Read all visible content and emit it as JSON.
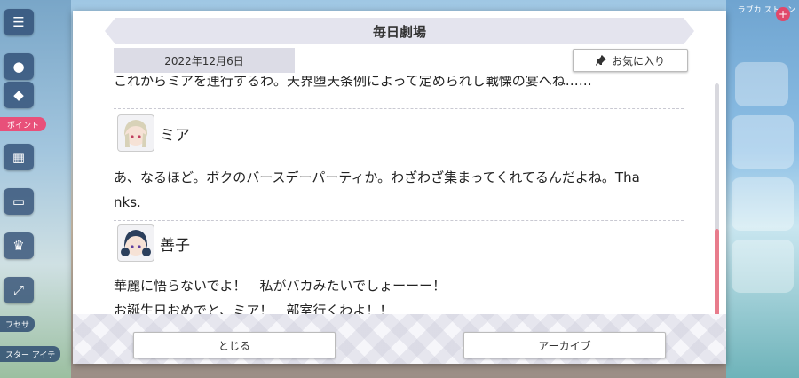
{
  "dialog": {
    "title": "毎日劇場",
    "date": "2022年12月6日",
    "favorite_label": "お気に入り",
    "cut_text": "これからミアを連行するわ。天界堕天条例によって定められし戦慄の宴へね……",
    "entries": [
      {
        "speaker": "ミア",
        "lines": [
          "あ、なるほど。ボクのバースデーパーティか。わざわざ集まってくれてるんだよね。Tha",
          "nks."
        ]
      },
      {
        "speaker": "善子",
        "lines": [
          "華麗に悟らないでよ！　私がバカみたいでしょーーー！",
          "お誕生日おめでと、ミア！　部室行くわよ！！"
        ]
      }
    ],
    "close_label": "とじる",
    "archive_label": "アーカイブ"
  },
  "background": {
    "badge_left": "ポイント",
    "label_left_1": "フセサ",
    "label_left_2": "スター アイテ",
    "top_right_text": "ラブカ ストーン"
  },
  "colors": {
    "scroll_thumb": "#e87c8c",
    "title_bar": "#e4e4ee",
    "date_box": "#dcdce6"
  }
}
